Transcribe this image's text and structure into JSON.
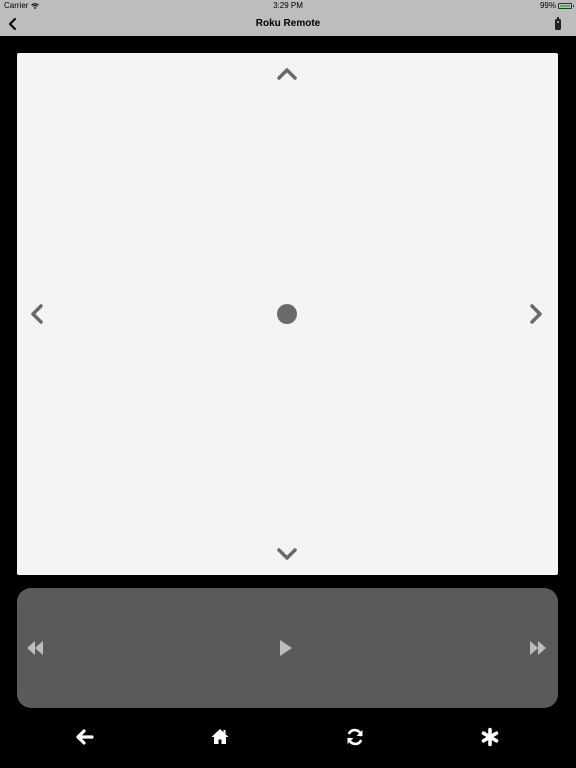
{
  "status_bar": {
    "carrier": "Carrier",
    "time": "3:29 PM",
    "battery_percent": "99%",
    "battery_level": 0.99,
    "wifi_icon": "wifi-icon"
  },
  "nav_bar": {
    "title": "Roku Remote",
    "back_icon": "chevron-left-icon",
    "device_icon": "remote-icon"
  },
  "dpad": {
    "up_icon": "chevron-up-icon",
    "down_icon": "chevron-down-icon",
    "left_icon": "chevron-left-icon",
    "right_icon": "chevron-right-icon",
    "select_icon": "select-dot-icon"
  },
  "media_controls": {
    "rewind_icon": "rewind-icon",
    "play_icon": "play-icon",
    "fast_forward_icon": "fast-forward-icon"
  },
  "bottom_bar": {
    "items": [
      {
        "icon": "arrow-left-icon"
      },
      {
        "icon": "home-icon"
      },
      {
        "icon": "refresh-icon"
      },
      {
        "icon": "asterisk-icon"
      }
    ]
  },
  "colors": {
    "background": "#000000",
    "bars": "#bdbdbd",
    "dpad_background": "#f4f4f4",
    "dpad_icon": "#6a6a6a",
    "media_background": "#5a5a5a",
    "media_icon": "#bdbdbd",
    "bottom_icon": "#ffffff",
    "battery_fill": "#3ac43a"
  }
}
